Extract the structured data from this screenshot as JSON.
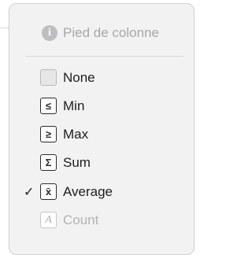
{
  "header": {
    "icon": "info-icon",
    "icon_glyph": "i",
    "label": "Pied de colonne"
  },
  "items": [
    {
      "key": "none",
      "label": "None",
      "icon": "empty-box-icon",
      "glyph": "",
      "checked": false,
      "enabled": true
    },
    {
      "key": "min",
      "label": "Min",
      "icon": "less-or-equal-icon",
      "glyph": "≤",
      "checked": false,
      "enabled": true
    },
    {
      "key": "max",
      "label": "Max",
      "icon": "greater-or-equal-icon",
      "glyph": "≥",
      "checked": false,
      "enabled": true
    },
    {
      "key": "sum",
      "label": "Sum",
      "icon": "sigma-icon",
      "glyph": "Σ",
      "checked": false,
      "enabled": true
    },
    {
      "key": "average",
      "label": "Average",
      "icon": "x-bar-icon",
      "glyph": "x̄",
      "checked": true,
      "enabled": true
    },
    {
      "key": "count",
      "label": "Count",
      "icon": "letter-a-icon",
      "glyph": "A",
      "checked": false,
      "enabled": false
    }
  ],
  "checkmark": "✓",
  "colors": {
    "menu_background": "#f2f2f2",
    "text": "#1d1d1f",
    "disabled_text": "#b3b3b6"
  }
}
